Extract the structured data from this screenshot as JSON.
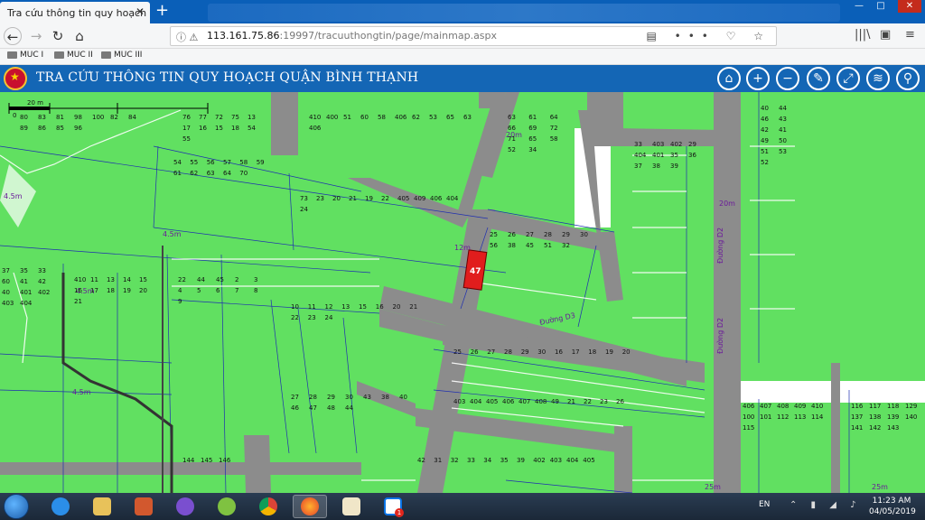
{
  "browser": {
    "tab_title": "Tra cứu thông tin quy hoạch",
    "url_host": "113.161.75.86",
    "url_rest": ":19997/tracuuthongtin/page/mainmap.aspx",
    "bookmarks": [
      "MUC I",
      "MUC II",
      "MUC III"
    ]
  },
  "app": {
    "title": "TRA CỨU THÔNG TIN QUY HOẠCH QUẬN BÌNH THẠNH",
    "tools": [
      {
        "icon": "home-icon",
        "glyph": "⌂"
      },
      {
        "icon": "zoom-in-icon",
        "glyph": "+"
      },
      {
        "icon": "zoom-out-icon",
        "glyph": "−"
      },
      {
        "icon": "measure-ruler-icon",
        "glyph": "✎"
      },
      {
        "icon": "full-extent-icon",
        "glyph": "⤢"
      },
      {
        "icon": "layers-icon",
        "glyph": "≋"
      },
      {
        "icon": "search-icon",
        "glyph": "⚲"
      }
    ]
  },
  "map": {
    "scale_label": "20 m",
    "scale_zero": "0",
    "selected_parcel": "47",
    "streets": [
      "Đường D2",
      "Đường D3",
      "Đường D2"
    ],
    "widths": [
      "4.5m",
      "4.5m",
      "4.5m",
      "4.5m",
      "12m",
      "20m",
      "25m",
      "25m",
      "20m"
    ],
    "parcel_labels": [
      "80",
      "83",
      "81",
      "98",
      "100",
      "82",
      "84",
      "89",
      "86",
      "85",
      "96",
      "76",
      "77",
      "72",
      "75",
      "13",
      "17",
      "16",
      "15",
      "18",
      "54",
      "55",
      "410",
      "400",
      "51",
      "60",
      "58",
      "406",
      "62",
      "53",
      "65",
      "63",
      "406",
      "63",
      "61",
      "64",
      "66",
      "69",
      "72",
      "71",
      "65",
      "58",
      "52",
      "34",
      "33",
      "403",
      "402",
      "29",
      "404",
      "401",
      "35",
      "36",
      "37",
      "38",
      "39",
      "40",
      "44",
      "46",
      "43",
      "42",
      "41",
      "49",
      "50",
      "51",
      "53",
      "52",
      "54",
      "55",
      "56",
      "57",
      "58",
      "59",
      "61",
      "62",
      "63",
      "64",
      "70",
      "73",
      "23",
      "20",
      "21",
      "19",
      "22",
      "405",
      "409",
      "406",
      "404",
      "24",
      "25",
      "26",
      "27",
      "28",
      "29",
      "30",
      "56",
      "38",
      "45",
      "51",
      "32",
      "37",
      "35",
      "33",
      "60",
      "41",
      "42",
      "40",
      "401",
      "402",
      "403",
      "404",
      "410",
      "11",
      "13",
      "14",
      "15",
      "16",
      "17",
      "18",
      "19",
      "20",
      "21",
      "22",
      "44",
      "45",
      "2",
      "3",
      "4",
      "5",
      "6",
      "7",
      "8",
      "9",
      "10",
      "11",
      "12",
      "13",
      "15",
      "16",
      "20",
      "21",
      "22",
      "23",
      "24",
      "25",
      "26",
      "27",
      "28",
      "29",
      "30",
      "16",
      "17",
      "18",
      "19",
      "20",
      "403",
      "404",
      "405",
      "406",
      "407",
      "408",
      "49",
      "21",
      "22",
      "23",
      "26",
      "27",
      "28",
      "29",
      "30",
      "43",
      "38",
      "40",
      "46",
      "47",
      "48",
      "44",
      "42",
      "31",
      "32",
      "33",
      "34",
      "35",
      "39",
      "402",
      "403",
      "404",
      "405",
      "406",
      "407",
      "408",
      "409",
      "410",
      "100",
      "101",
      "112",
      "113",
      "114",
      "115",
      "116",
      "117",
      "118",
      "129",
      "137",
      "138",
      "139",
      "140",
      "141",
      "142",
      "143",
      "144",
      "145",
      "146"
    ]
  },
  "taskbar": {
    "lang": "EN",
    "time": "11:23 AM",
    "date": "04/05/2019",
    "zalo_badge": "1"
  }
}
